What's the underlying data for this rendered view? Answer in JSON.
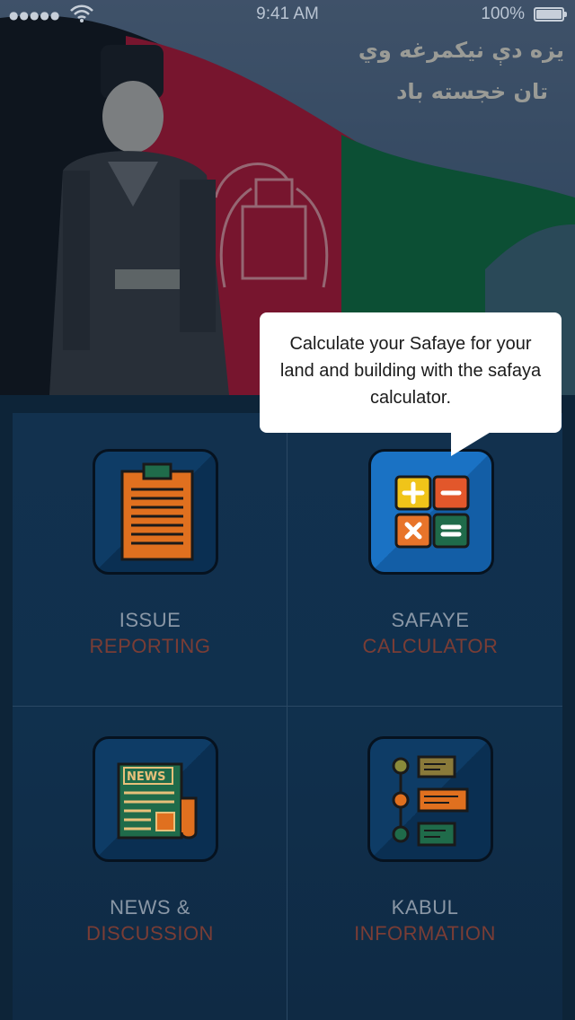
{
  "status_bar": {
    "signal": "●●●●●",
    "time": "9:41 AM",
    "battery_percent": "100%",
    "battery_level": 1.0,
    "icons": [
      "signal-dots-icon",
      "wifi-icon",
      "battery-icon"
    ]
  },
  "banner": {
    "line1": "یزه دې نیکمرغه وي",
    "line2": "تان خجسته باد",
    "flag_colors": [
      "#111111",
      "#c8102e",
      "#007a36"
    ]
  },
  "tooltip": {
    "text": "Calculate your Safaye for your land and building with the safaya calculator."
  },
  "tiles": [
    {
      "line1": "ISSUE",
      "line2": "REPORTING",
      "icon": "clipboard-icon"
    },
    {
      "line1": "SAFAYE",
      "line2": "CALCULATOR",
      "icon": "calculator-icon"
    },
    {
      "line1": "NEWS &",
      "line2": "DISCUSSION",
      "icon": "newspaper-icon"
    },
    {
      "line1": "KABUL",
      "line2": "INFORMATION",
      "icon": "timeline-list-icon"
    }
  ],
  "colors": {
    "background": "#0d2438",
    "label_primary": "#8a97a6",
    "label_secondary": "#7a3d35",
    "calc_plus": "#f0c419",
    "calc_minus": "#e2572b",
    "calc_times": "#e8742a",
    "calc_equals": "#1f6b4a"
  }
}
